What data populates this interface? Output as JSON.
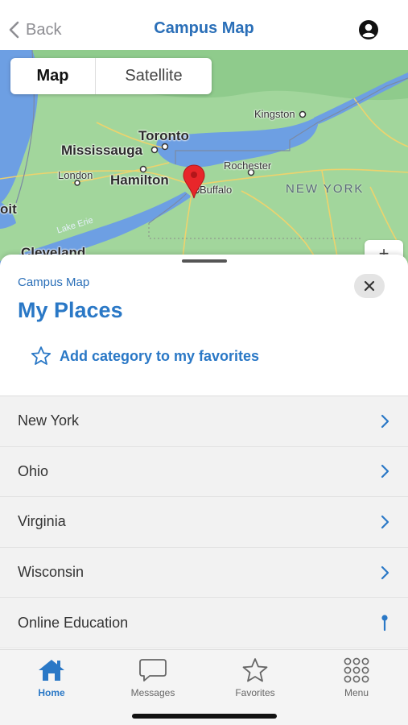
{
  "nav": {
    "back_label": "Back",
    "title": "Campus Map"
  },
  "map": {
    "mode_options": [
      "Map",
      "Satellite"
    ],
    "selected_mode": "Map",
    "labels": {
      "toronto": "Toronto",
      "mississauga": "Mississauga",
      "kingston": "Kingston",
      "london": "London",
      "hamilton": "Hamilton",
      "rochester": "Rochester",
      "buffalo": "Buffalo",
      "new_york": "NEW YORK",
      "detroit": "oit",
      "lake_erie": "Lake Erie",
      "cleveland": "Cleveland"
    },
    "colors": {
      "land": "#9fd39a",
      "water": "#6c9fe6",
      "pin": "#e8262a"
    }
  },
  "sheet": {
    "eyebrow": "Campus Map",
    "heading": "My Places",
    "favorite_action": "Add category to my favorites",
    "items": [
      {
        "label": "New York",
        "icon": "chevron-right-icon"
      },
      {
        "label": "Ohio",
        "icon": "chevron-right-icon"
      },
      {
        "label": "Virginia",
        "icon": "chevron-right-icon"
      },
      {
        "label": "Wisconsin",
        "icon": "chevron-right-icon"
      },
      {
        "label": "Online Education",
        "icon": "location-pin-icon"
      }
    ]
  },
  "tabbar": {
    "tabs": [
      {
        "label": "Home",
        "icon": "home-icon",
        "active": true
      },
      {
        "label": "Messages",
        "icon": "chat-bubble-icon",
        "active": false
      },
      {
        "label": "Favorites",
        "icon": "star-icon",
        "active": false
      },
      {
        "label": "Menu",
        "icon": "grid-dots-icon",
        "active": false
      }
    ]
  },
  "accent_color": "#2a78c6"
}
